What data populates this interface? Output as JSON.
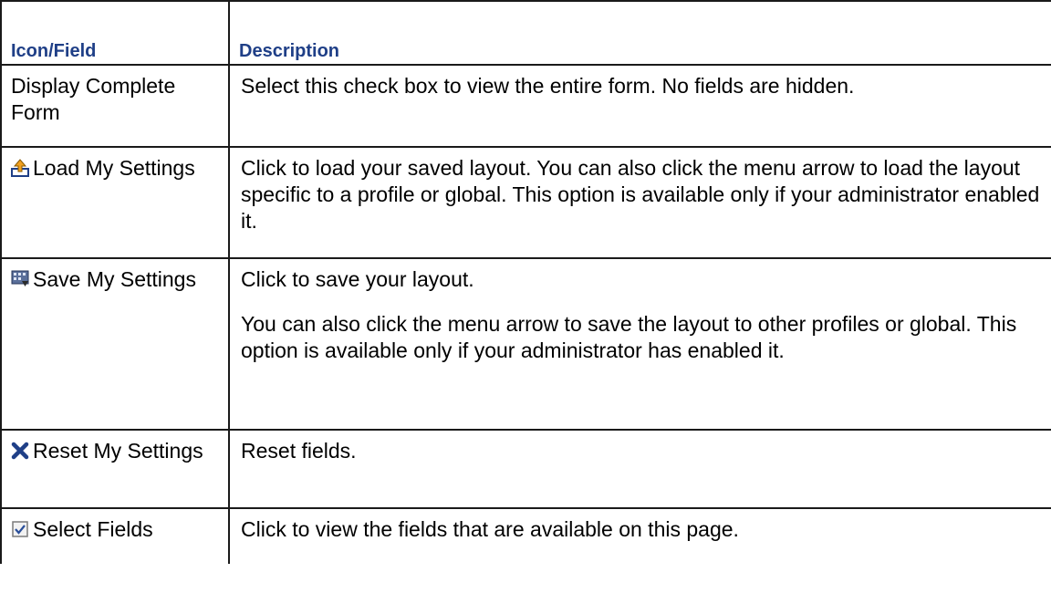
{
  "table": {
    "headers": {
      "field": "Icon/Field",
      "description": "Description"
    },
    "rows": [
      {
        "icon": "",
        "field": "Display Complete Form",
        "description": [
          "Select this check box to view the entire form. No fields are hidden."
        ]
      },
      {
        "icon": "load-settings-icon",
        "field": "Load My Settings",
        "description": [
          "Click to load your saved layout. You can also click the menu arrow to load the layout specific to a profile or global. This option is available only if your administrator enabled it."
        ]
      },
      {
        "icon": "save-settings-icon",
        "field": "Save My Settings",
        "description": [
          "Click to save your layout.",
          "You can also click the menu arrow to save the layout to other profiles or global. This option is available only if your administrator has enabled it."
        ]
      },
      {
        "icon": "reset-x-icon",
        "field": "Reset My Settings",
        "description": [
          "Reset fields."
        ]
      },
      {
        "icon": "select-fields-checkbox-icon",
        "field": "Select Fields",
        "description": [
          "Click to view the fields that are available on this page."
        ]
      }
    ]
  },
  "colors": {
    "header_text": "#1f3f87",
    "border": "#1a1a1a",
    "reset_icon": "#1f3f87"
  }
}
